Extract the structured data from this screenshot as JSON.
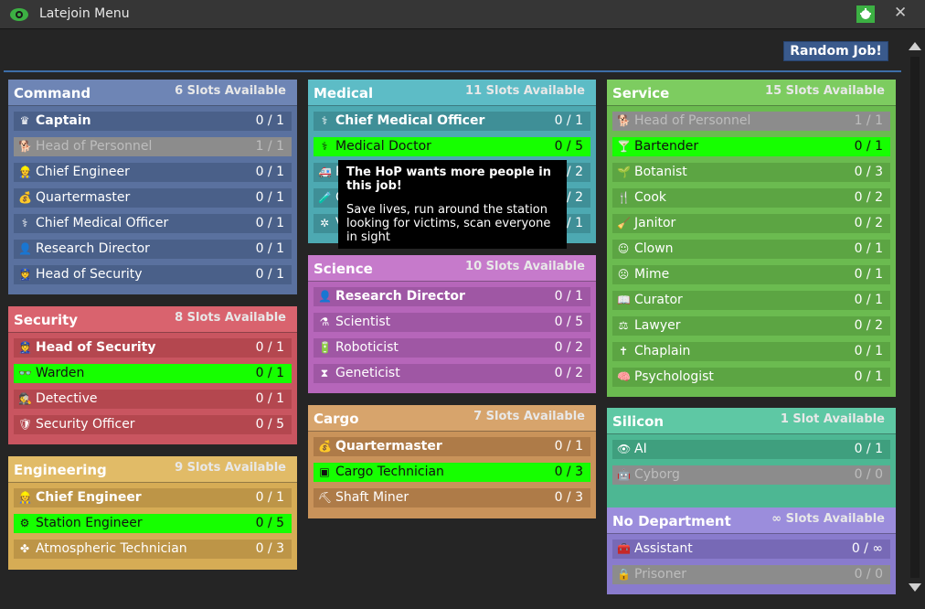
{
  "window": {
    "title": "Latejoin Menu",
    "close_glyph": "✕",
    "eye_icon": "eye-icon",
    "bug_icon": "bug-icon"
  },
  "random_job_button": "Random Job!",
  "tooltip": {
    "title": "The HoP wants more people in this job!",
    "description": "Save lives, run around the station looking for victims, scan everyone in sight"
  },
  "colors": {
    "command": {
      "header": "#6e85b5",
      "body": "#5a719f",
      "row": "#4a6089"
    },
    "security": {
      "header": "#d9636e",
      "body": "#c95560",
      "row": "#b4474f"
    },
    "engineering": {
      "header": "#e1bb67",
      "body": "#d6ac55",
      "row": "#bd9547"
    },
    "medical": {
      "header": "#5dbcc6",
      "body": "#4da9b2",
      "row": "#3f8f97"
    },
    "science": {
      "header": "#c67acb",
      "body": "#b666ba",
      "row": "#9f57a4"
    },
    "cargo": {
      "header": "#d7a46c",
      "body": "#c9935a",
      "row": "#ae7b48"
    },
    "service": {
      "header": "#7dcc60",
      "body": "#6bbb50",
      "row": "#5ca543"
    },
    "silicon": {
      "header": "#5ec8a4",
      "body": "#4db793",
      "row": "#3f9f7e"
    },
    "nodept": {
      "header": "#9b8ddc",
      "body": "#897bcd",
      "row": "#7769b6"
    },
    "priority": "#16ff00"
  },
  "departments": {
    "command": {
      "name": "Command",
      "slots": "6 Slots Available",
      "jobs": [
        {
          "name": "Captain",
          "slots": "0 / 1",
          "icon": "♛"
        },
        {
          "name": "Head of Personnel",
          "slots": "1 / 1",
          "icon": "🐕"
        },
        {
          "name": "Chief Engineer",
          "slots": "0 / 1",
          "icon": "👷"
        },
        {
          "name": "Quartermaster",
          "slots": "0 / 1",
          "icon": "💰"
        },
        {
          "name": "Chief Medical Officer",
          "slots": "0 / 1",
          "icon": "⚕"
        },
        {
          "name": "Research Director",
          "slots": "0 / 1",
          "icon": "👤"
        },
        {
          "name": "Head of Security",
          "slots": "0 / 1",
          "icon": "👮"
        }
      ]
    },
    "security": {
      "name": "Security",
      "slots": "8 Slots Available",
      "jobs": [
        {
          "name": "Head of Security",
          "slots": "0 / 1",
          "icon": "👮"
        },
        {
          "name": "Warden",
          "slots": "0 / 1",
          "icon": "👓"
        },
        {
          "name": "Detective",
          "slots": "0 / 1",
          "icon": "🕵"
        },
        {
          "name": "Security Officer",
          "slots": "0 / 5",
          "icon": "🛡"
        }
      ]
    },
    "engineering": {
      "name": "Engineering",
      "slots": "9 Slots Available",
      "jobs": [
        {
          "name": "Chief Engineer",
          "slots": "0 / 1",
          "icon": "👷"
        },
        {
          "name": "Station Engineer",
          "slots": "0 / 5",
          "icon": "⚙"
        },
        {
          "name": "Atmospheric Technician",
          "slots": "0 / 3",
          "icon": "✤"
        }
      ]
    },
    "medical": {
      "name": "Medical",
      "slots": "11 Slots Available",
      "jobs": [
        {
          "name": "Chief Medical Officer",
          "slots": "0 / 1",
          "icon": "⚕"
        },
        {
          "name": "Medical Doctor",
          "slots": "0 / 5",
          "icon": "⚕"
        },
        {
          "name": "Paramedic",
          "slots": "0 / 2",
          "icon": "🚑"
        },
        {
          "name": "Chemist",
          "slots": "0 / 2",
          "icon": "🧪"
        },
        {
          "name": "Virologist",
          "slots": "0 / 1",
          "icon": "✲"
        }
      ]
    },
    "science": {
      "name": "Science",
      "slots": "10 Slots Available",
      "jobs": [
        {
          "name": "Research Director",
          "slots": "0 / 1",
          "icon": "👤"
        },
        {
          "name": "Scientist",
          "slots": "0 / 5",
          "icon": "⚗"
        },
        {
          "name": "Roboticist",
          "slots": "0 / 2",
          "icon": "🔋"
        },
        {
          "name": "Geneticist",
          "slots": "0 / 2",
          "icon": "⧗"
        }
      ]
    },
    "cargo": {
      "name": "Cargo",
      "slots": "7 Slots Available",
      "jobs": [
        {
          "name": "Quartermaster",
          "slots": "0 / 1",
          "icon": "💰"
        },
        {
          "name": "Cargo Technician",
          "slots": "0 / 3",
          "icon": "▣"
        },
        {
          "name": "Shaft Miner",
          "slots": "0 / 3",
          "icon": "⛏"
        }
      ]
    },
    "service": {
      "name": "Service",
      "slots": "15 Slots Available",
      "jobs": [
        {
          "name": "Head of Personnel",
          "slots": "1 / 1",
          "icon": "🐕"
        },
        {
          "name": "Bartender",
          "slots": "0 / 1",
          "icon": "🍸"
        },
        {
          "name": "Botanist",
          "slots": "0 / 3",
          "icon": "🌱"
        },
        {
          "name": "Cook",
          "slots": "0 / 2",
          "icon": "🍴"
        },
        {
          "name": "Janitor",
          "slots": "0 / 2",
          "icon": "🧹"
        },
        {
          "name": "Clown",
          "slots": "0 / 1",
          "icon": "☺"
        },
        {
          "name": "Mime",
          "slots": "0 / 1",
          "icon": "☹"
        },
        {
          "name": "Curator",
          "slots": "0 / 1",
          "icon": "📖"
        },
        {
          "name": "Lawyer",
          "slots": "0 / 2",
          "icon": "⚖"
        },
        {
          "name": "Chaplain",
          "slots": "0 / 1",
          "icon": "✝"
        },
        {
          "name": "Psychologist",
          "slots": "0 / 1",
          "icon": "🧠"
        }
      ]
    },
    "silicon": {
      "name": "Silicon",
      "slots": "1 Slot Available",
      "jobs": [
        {
          "name": "AI",
          "slots": "0 / 1",
          "icon": "👁"
        },
        {
          "name": "Cyborg",
          "slots": "0 / 0",
          "icon": "🤖"
        }
      ]
    },
    "nodept": {
      "name": "No Department",
      "slots": "∞ Slots Available",
      "jobs": [
        {
          "name": "Assistant",
          "slots": "0 / ∞",
          "icon": "🧰"
        },
        {
          "name": "Prisoner",
          "slots": "0 / 0",
          "icon": "🔒"
        }
      ]
    }
  }
}
